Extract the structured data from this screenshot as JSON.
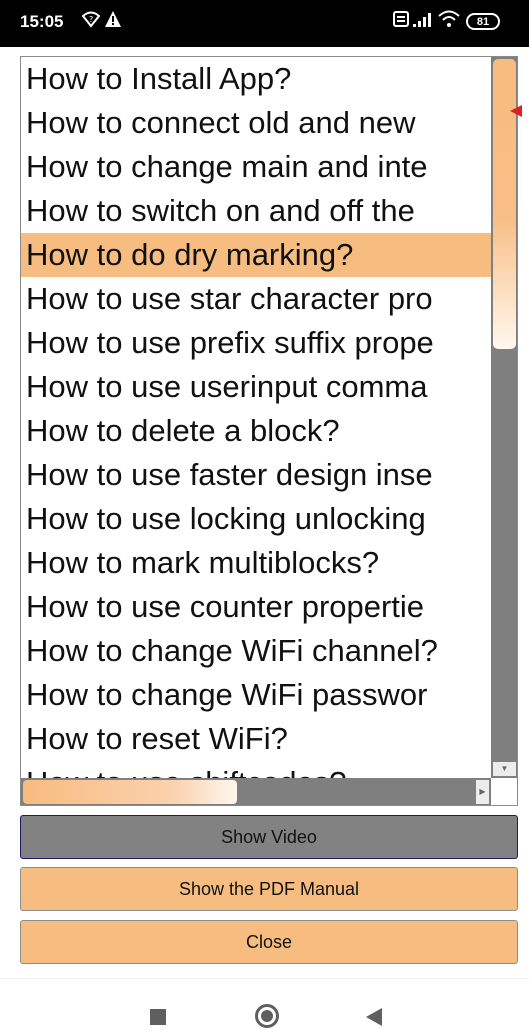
{
  "status": {
    "time": "15:05",
    "battery": "81",
    "icons": [
      "wifi-question-icon",
      "warning-icon",
      "volte-icon",
      "signal-icon",
      "wifi-icon",
      "battery-icon"
    ]
  },
  "list": {
    "selected_index": 4,
    "items": [
      "How to Install App?",
      "How to connect old and new",
      "How to change main and inte",
      "How to switch on and off the",
      "How to do dry marking?",
      "How to use star character pro",
      "How to use prefix suffix prope",
      "How to use userinput comma",
      "How to delete a block?",
      "How to use faster design inse",
      "How to use locking unlocking",
      "How to mark multiblocks?",
      "How to use counter propertie",
      "How to change WiFi channel?",
      "How to change WiFi passwor",
      "How to reset WiFi?",
      "How to use shiftcodes?"
    ]
  },
  "buttons": {
    "show_video": "Show Video",
    "show_pdf": "Show the PDF Manual",
    "close": "Close"
  },
  "colors": {
    "accent": "#f7bd80",
    "scroll_track": "#7f7f7f",
    "disabled_button": "#828282"
  }
}
